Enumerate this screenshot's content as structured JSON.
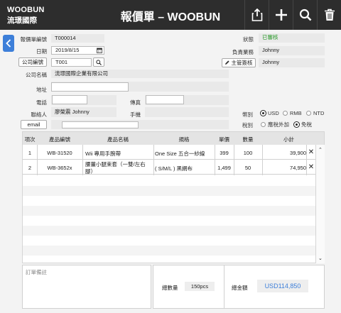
{
  "header": {
    "logo_en": "WOOBUN",
    "logo_zh": "流璟國際",
    "title": "報價單 – WOOBUN"
  },
  "form": {
    "quote_no": {
      "label": "報價單編號",
      "value": "T000014"
    },
    "date": {
      "label": "日期",
      "value": "2019/8/15"
    },
    "company_no": {
      "label": "公司編號",
      "value": "T001"
    },
    "company_name": {
      "label": "公司名稱",
      "value": "流璟國際企業有限公司"
    },
    "address": {
      "label": "地址",
      "value": ""
    },
    "phone": {
      "label": "電話",
      "value": ""
    },
    "fax": {
      "label": "傳真",
      "value": ""
    },
    "contact": {
      "label": "聯絡人",
      "value": "廖榮震 Johnny"
    },
    "mobile": {
      "label": "手機",
      "value": ""
    },
    "email": {
      "label": "email",
      "value": ""
    },
    "status": {
      "label": "狀態",
      "value": "已審核"
    },
    "salesperson": {
      "label": "負責業務",
      "value": "Johnny"
    },
    "manager_sign": {
      "label": "主管簽核",
      "value": "Johnny"
    },
    "currency": {
      "label": "幣別",
      "options": [
        "USD",
        "RMB",
        "NTD"
      ],
      "selected": "USD"
    },
    "tax": {
      "label": "稅別",
      "options": [
        "應稅外加",
        "免稅"
      ],
      "selected": "免稅"
    }
  },
  "table": {
    "headers": [
      "項次",
      "產品編號",
      "產品名稱",
      "規格",
      "單價",
      "數量",
      "小計"
    ],
    "rows": [
      {
        "no": "1",
        "code": "WB-31520",
        "name": "Wii 專用手腕帶",
        "spec": "One Size 五合一紗線",
        "price": "399",
        "qty": "100",
        "subtotal": "39,900"
      },
      {
        "no": "2",
        "code": "WB-3652x",
        "name": "腰薑小腿束套（一雙/左右腳）",
        "spec": "( S/M/L ) 黑網布",
        "price": "1,499",
        "qty": "50",
        "subtotal": "74,950"
      }
    ]
  },
  "footer": {
    "remark_label": "訂單備註",
    "total_qty_label": "總數量",
    "total_qty": "150pcs",
    "total_amount_label": "總金額",
    "total_amount": "USD114,850"
  },
  "colors": {
    "accent": "#3d7fd9",
    "status_green": "#2a9a2a",
    "header_bg": "#2d2d2d"
  }
}
